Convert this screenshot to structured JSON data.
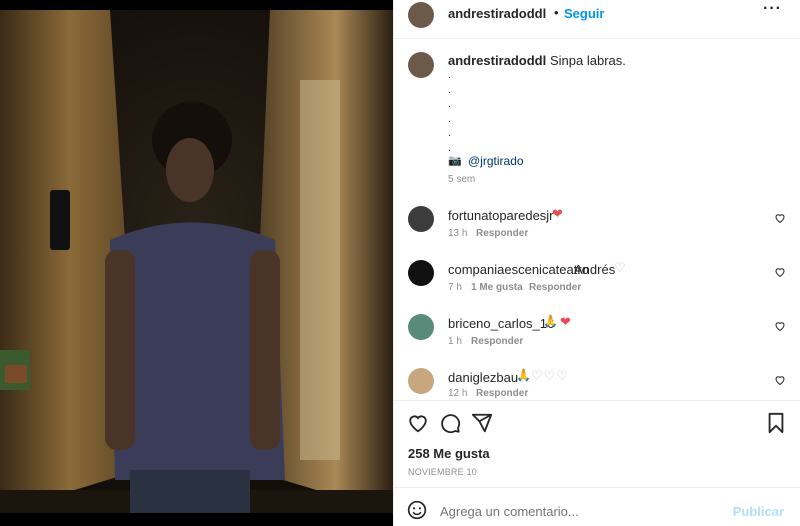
{
  "post": {
    "author": "andrestiradoddl",
    "follow_label": "Seguir",
    "caption_text": "Sinpa labras.",
    "caption_dots": [
      ".",
      ".",
      ".",
      ".",
      ".",
      "."
    ],
    "mention": "@jrgtirado",
    "time_ago": "5 sem"
  },
  "comments": [
    {
      "user": "fortunatoparedesjr",
      "text": "",
      "time": "13 h",
      "likes": "",
      "reply": "Responder"
    },
    {
      "user": "companiaescenicateatro",
      "text": "Andrés",
      "time": "7 h",
      "likes": "1 Me gusta",
      "reply": "Responder"
    },
    {
      "user": "briceno_carlos_16",
      "text": "",
      "time": "1 h",
      "likes": "",
      "reply": "Responder"
    },
    {
      "user": "daniglezbau",
      "text": "",
      "time": "12 h",
      "likes": "",
      "reply": "Responder"
    }
  ],
  "stats": {
    "likes": "258 Me gusta",
    "date": "NOVIEMBRE 10"
  },
  "composer": {
    "placeholder": "Agrega un comentario...",
    "publish": "Publicar"
  },
  "colors": {
    "link": "#0095f6",
    "heart": "#ed4956",
    "muted": "#8e8e8e"
  },
  "icons": [
    "more-icon",
    "heart-icon",
    "comment-icon",
    "share-icon",
    "bookmark-icon",
    "emoji-icon",
    "camera-emoji-icon"
  ]
}
